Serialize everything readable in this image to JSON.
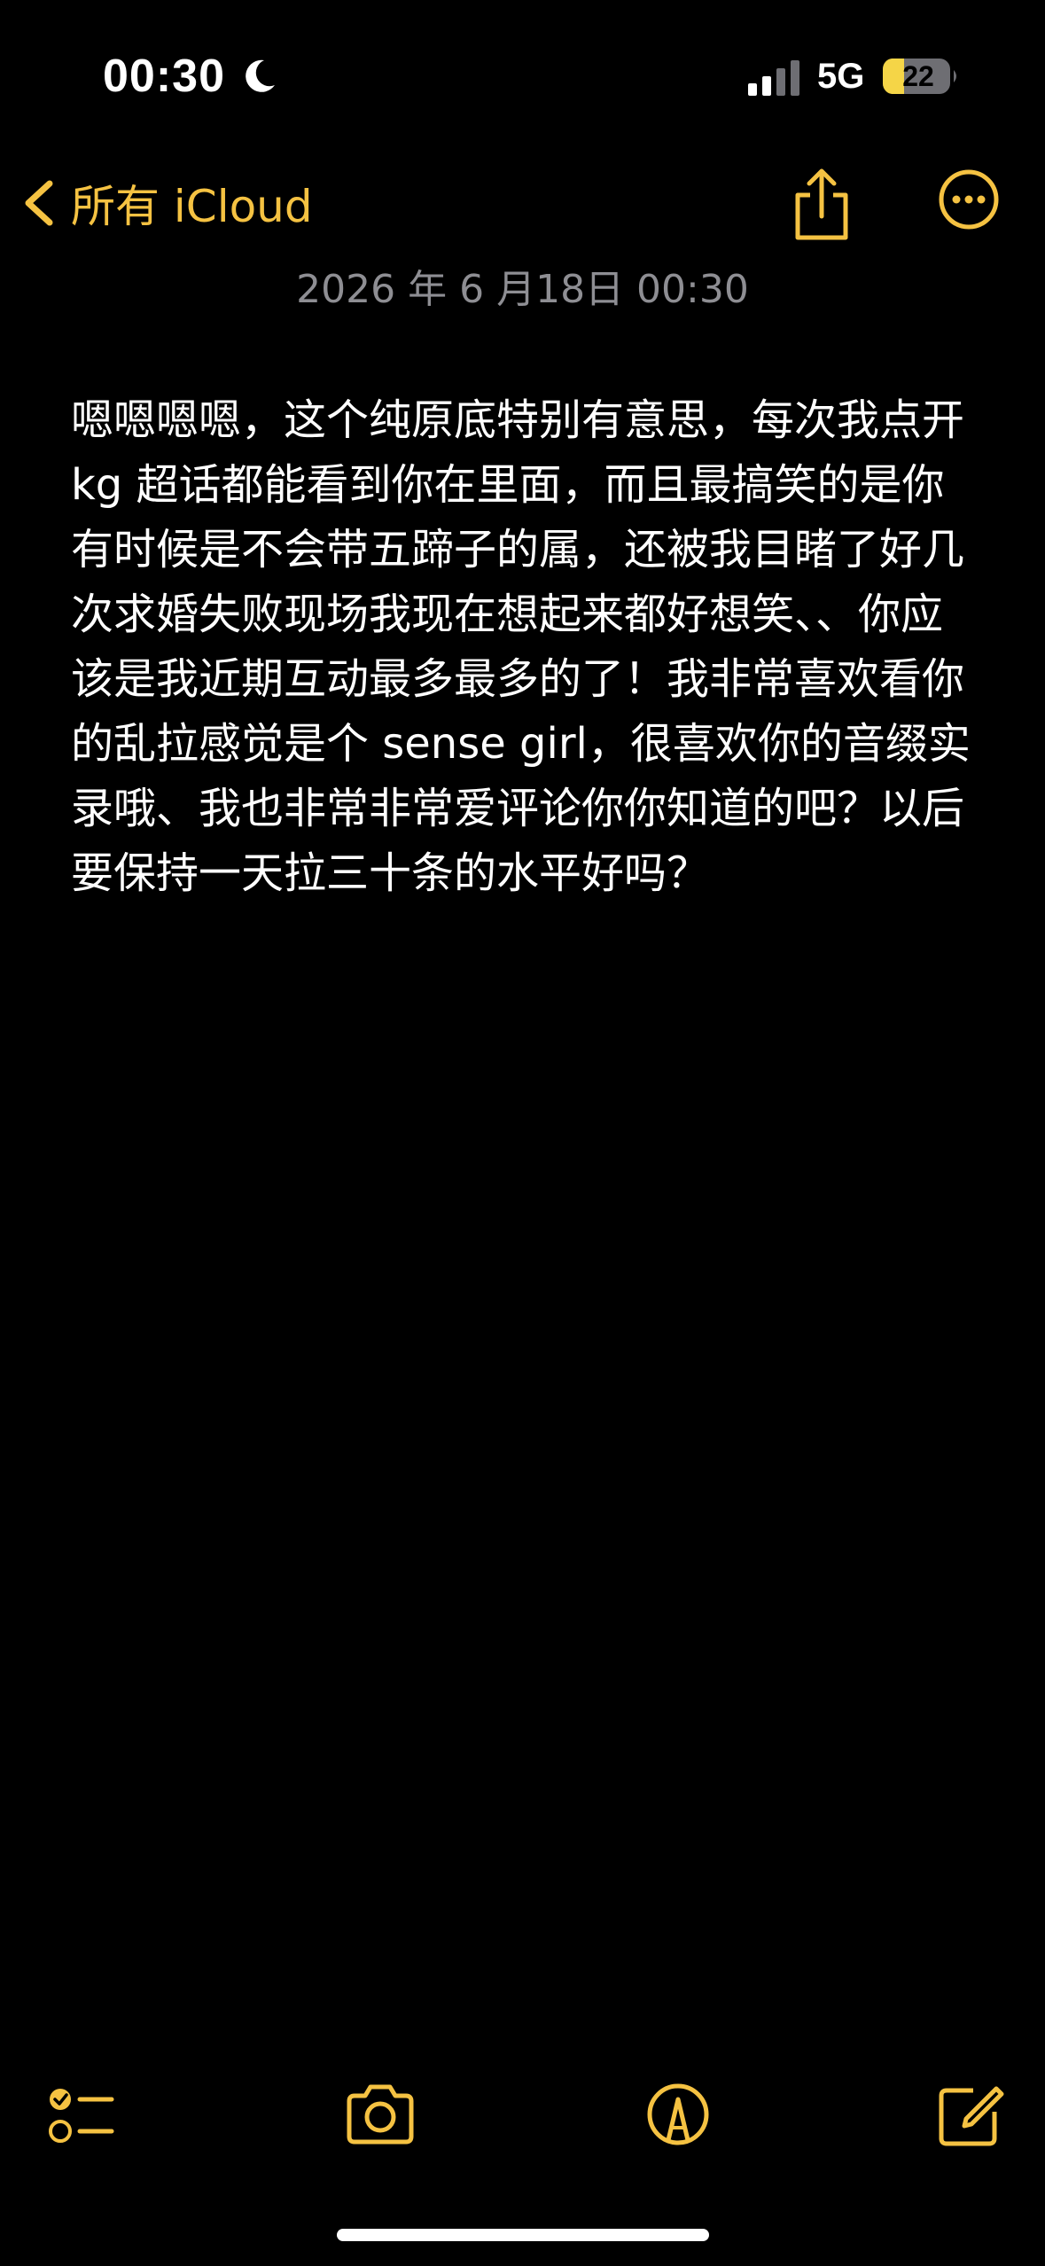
{
  "status_bar": {
    "time": "00:30",
    "network": "5G",
    "battery_level": "22"
  },
  "nav": {
    "back_label": "所有 iCloud"
  },
  "note": {
    "date": "2026 年 6 月18日 00:30",
    "body": "嗯嗯嗯嗯，这个纯原底特别有意思，每次我点开 kg 超话都能看到你在里面，而且最搞笑的是你有时候是不会带五蹄子的属，还被我目睹了好几次求婚失败现场我现在想起来都好想笑、、你应该是我近期互动最多最多的了！我非常喜欢看你的乱拉感觉是个 sense girl，很喜欢你的音缀实录哦、我也非常非常爱评论你你知道的吧？以后要保持一天拉三十条的水平好吗？"
  },
  "colors": {
    "accent": "#f5c242",
    "background": "#000000",
    "text": "#ffffff",
    "secondary_text": "#8e8e93"
  },
  "icons": {
    "moon": "moon-icon",
    "signal": "cellular-signal-icon",
    "battery": "battery-icon",
    "back": "chevron-left-icon",
    "share": "share-icon",
    "more": "more-ellipsis-icon",
    "checklist": "checklist-icon",
    "camera": "camera-icon",
    "markup": "markup-pen-icon",
    "compose": "compose-icon"
  }
}
